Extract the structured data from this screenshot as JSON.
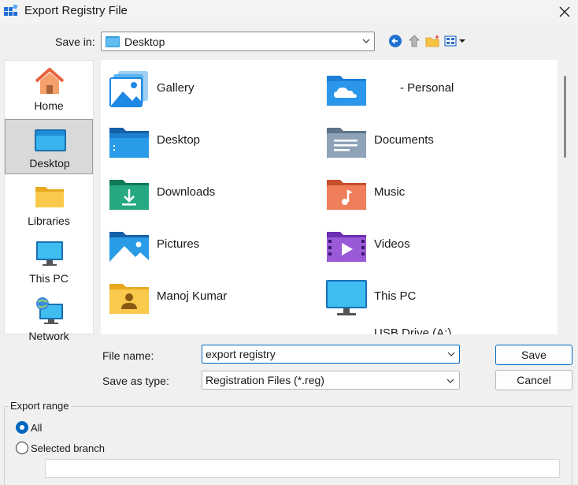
{
  "window": {
    "title": "Export Registry File",
    "icon": "registry-editor-icon"
  },
  "save_in": {
    "label": "Save in:",
    "value": "Desktop"
  },
  "places": [
    {
      "label": "Home",
      "icon": "home-icon",
      "selected": false
    },
    {
      "label": "Desktop",
      "icon": "desktop-icon",
      "selected": true
    },
    {
      "label": "Libraries",
      "icon": "libraries-icon",
      "selected": false
    },
    {
      "label": "This PC",
      "icon": "this-pc-icon",
      "selected": false
    },
    {
      "label": "Network",
      "icon": "network-icon",
      "selected": false
    }
  ],
  "items": [
    {
      "label": "Gallery",
      "icon": "gallery-icon"
    },
    {
      "label": "- Personal",
      "icon": "onedrive-icon"
    },
    {
      "label": "Desktop",
      "icon": "desktop-folder-icon"
    },
    {
      "label": "Documents",
      "icon": "documents-folder-icon"
    },
    {
      "label": "Downloads",
      "icon": "downloads-folder-icon"
    },
    {
      "label": "Music",
      "icon": "music-folder-icon"
    },
    {
      "label": "Pictures",
      "icon": "pictures-folder-icon"
    },
    {
      "label": "Videos",
      "icon": "videos-folder-icon"
    },
    {
      "label": "Manoj Kumar",
      "icon": "user-folder-icon"
    },
    {
      "label": "This PC",
      "icon": "monitor-icon"
    },
    {
      "label": "USB Drive (A:)",
      "icon": "usb-drive-icon"
    }
  ],
  "file_name": {
    "label": "File name:",
    "value": "export registry"
  },
  "save_as_type": {
    "label": "Save as type:",
    "value": "Registration Files (*.reg)"
  },
  "buttons": {
    "save": "Save",
    "cancel": "Cancel"
  },
  "export_range": {
    "legend": "Export range",
    "options": [
      {
        "label": "All",
        "checked": true
      },
      {
        "label": "Selected branch",
        "checked": false
      }
    ],
    "branch_value": ""
  },
  "colors": {
    "accent": "#0067c0",
    "folder": "#f6c343",
    "background": "#f0f0f0"
  }
}
